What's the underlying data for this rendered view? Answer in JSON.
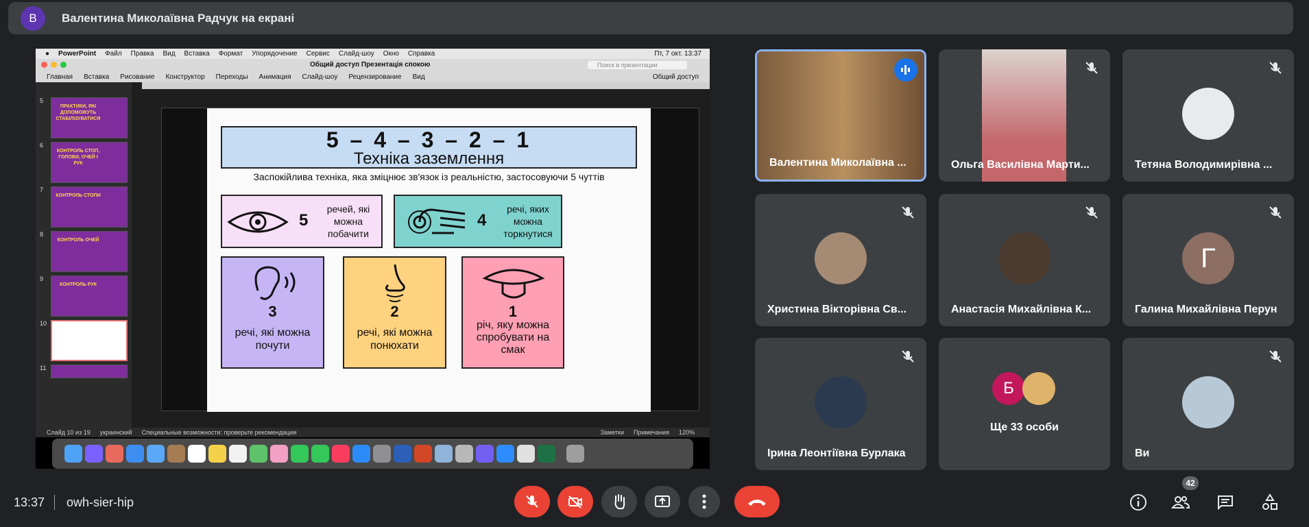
{
  "top_bar": {
    "avatar_letter": "В",
    "title": "Валентина Миколаївна Радчук на екрані"
  },
  "shared_screen": {
    "mac_menu": [
      "PowerPoint",
      "Файл",
      "Правка",
      "Вид",
      "Вставка",
      "Формат",
      "Упорядочение",
      "Сервис",
      "Слайд-шоу",
      "Окно",
      "Справка"
    ],
    "clock": "Пт, 7 окт.  13:37",
    "window_title": "Общий доступ Презентація спокою",
    "search_placeholder": "Поиск в презентации",
    "ribbon_tabs": [
      "Главная",
      "Вставка",
      "Рисование",
      "Конструктор",
      "Переходы",
      "Анимация",
      "Слайд-шоу",
      "Рецензирование",
      "Вид"
    ],
    "share_button": "Общий доступ",
    "thumbs": [
      {
        "num": "5",
        "label": "ПРАКТИКИ, ЯКІ ДОПОМОЖУТЬ СТАБІЛІЗУВАТИСЯ"
      },
      {
        "num": "6",
        "label": "КОНТРОЛЬ СТОП, ГОЛОВИ, ОЧЕЙ І РУК"
      },
      {
        "num": "7",
        "label": "КОНТРОЛЬ СТОПИ"
      },
      {
        "num": "8",
        "label": "КОНТРОЛЬ ОЧЕЙ"
      },
      {
        "num": "9",
        "label": "КОНТРОЛЬ РУК"
      },
      {
        "num": "10",
        "label": ""
      },
      {
        "num": "11",
        "label": ""
      }
    ],
    "slide": {
      "numbers": "5 – 4 – 3 – 2 – 1",
      "title": "Техніка заземлення",
      "subtitle": "Заспокійлива техніка, яка зміцнює зв'язок із реальністю, застосовуючи 5 чуттів",
      "cards": [
        {
          "num": "5",
          "text": "речей, які можна побачити"
        },
        {
          "num": "4",
          "text": "речі, яких можна торкнутися"
        },
        {
          "num": "3",
          "text": "речі, які можна почути"
        },
        {
          "num": "2",
          "text": "речі, які можна понюхати"
        },
        {
          "num": "1",
          "text": "річ, яку можна спробувати на смак"
        }
      ]
    },
    "status": {
      "slide": "Слайд 10 из 19",
      "lang": "украинский",
      "access": "Специальные возможности: проверьте рекомендации",
      "notes": "Заметки",
      "comments": "Примечания",
      "zoom": "120%"
    }
  },
  "participants": [
    {
      "name": "Валентина Миколаївна ...",
      "muted": false
    },
    {
      "name": "Ольга Василівна Марти...",
      "muted": true
    },
    {
      "name": "Тетяна Володимирівна ...",
      "muted": true
    },
    {
      "name": "Христина Вікторівна Св...",
      "muted": true
    },
    {
      "name": "Анастасія Михайлівна К...",
      "muted": true
    },
    {
      "name": "Галина Михайлівна Перун",
      "muted": true,
      "letter": "Г"
    },
    {
      "name": "Ірина Леонтіївна Бурлака",
      "muted": true
    },
    {
      "name": "Ще 33 особи",
      "letter": "Б"
    },
    {
      "name": "Ви",
      "muted": true
    }
  ],
  "bottom": {
    "time": "13:37",
    "meeting_code": "owh-sier-hip",
    "people_count": "42"
  },
  "colors": {
    "accent": "#8ab4f8",
    "danger": "#ea4335",
    "tile": "#3c4043"
  }
}
